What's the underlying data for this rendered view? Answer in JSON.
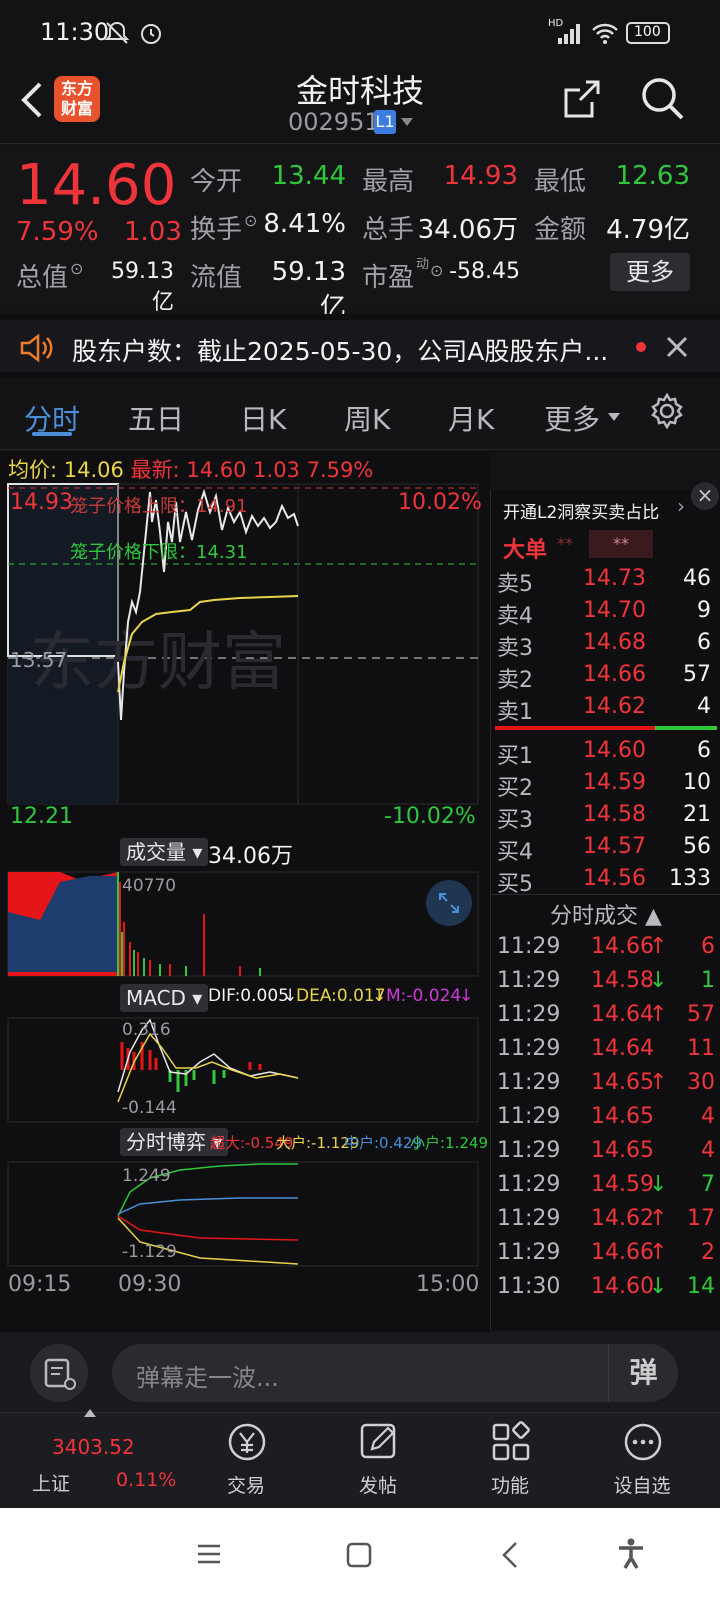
{
  "status_bar": {
    "time": "11:30",
    "network": "HD",
    "battery": "100"
  },
  "header": {
    "logo_line1": "东方",
    "logo_line2": "财富",
    "title": "金时科技",
    "code": "002951",
    "level_badge": "L1"
  },
  "quote": {
    "price": "14.60",
    "change_pct": "7.59%",
    "change": "1.03",
    "open_label": "今开",
    "open": "13.44",
    "high_label": "最高",
    "high": "14.93",
    "low_label": "最低",
    "low": "12.63",
    "turnover_label": "换手",
    "turnover": "8.41%",
    "volume_label": "总手",
    "volume": "34.06万",
    "amount_label": "金额",
    "amount": "4.79亿",
    "mktcap_label": "总值",
    "mktcap": "59.13亿",
    "float_label": "流值",
    "float": "59.13亿",
    "pe_label": "市盈",
    "pe_sup": "动",
    "pe": "-58.45",
    "more_btn": "更多"
  },
  "notice": {
    "text": "股东户数：截止2025-05-30，公司A股股东户..."
  },
  "tabs": {
    "t1": "分时",
    "t2": "五日",
    "t3": "日K",
    "t4": "周K",
    "t5": "月K",
    "t6": "更多"
  },
  "chart": {
    "avg_label": "均价:",
    "avg": "14.06",
    "latest_label": "最新:",
    "latest": "14.60",
    "latest_chg": "1.03",
    "latest_pct": "7.59%",
    "top_price": "14.93",
    "upper_limit_label": "笼子价格上限：14.91",
    "lower_limit_label": "笼子价格下限：14.31",
    "top_pct": "10.02%",
    "mid_price": "13.57",
    "bottom_price": "12.21",
    "bottom_pct": "-10.02%",
    "watermark": "东方财富",
    "volume_tag": "成交量",
    "volume_total": "34.06万",
    "volume_max": "40770",
    "macd_tag": "MACD",
    "dif": "DIF:0.005",
    "dea": "DEA:0.017",
    "m": "M:-0.024",
    "macd_hi": "0.316",
    "macd_lo": "-0.144",
    "game_tag": "分时博弈",
    "super": "超大:-0.549",
    "large": "大户:-1.129",
    "medium": "中户:0.429",
    "small": "小户:1.249",
    "game_hi": "1.249",
    "game_lo": "-1.129",
    "t_start": "09:15",
    "t_open": "09:30",
    "t_end": "15:00"
  },
  "book": {
    "l2_prompt": "开通L2洞察买卖占比",
    "big_order": "大单",
    "big_stars1": "**",
    "big_stars2": "**",
    "asks": [
      {
        "label": "卖5",
        "price": "14.73",
        "vol": "46"
      },
      {
        "label": "卖4",
        "price": "14.70",
        "vol": "9"
      },
      {
        "label": "卖3",
        "price": "14.68",
        "vol": "6"
      },
      {
        "label": "卖2",
        "price": "14.66",
        "vol": "57"
      },
      {
        "label": "卖1",
        "price": "14.62",
        "vol": "4"
      }
    ],
    "bids": [
      {
        "label": "买1",
        "price": "14.60",
        "vol": "6"
      },
      {
        "label": "买2",
        "price": "14.59",
        "vol": "10"
      },
      {
        "label": "买3",
        "price": "14.58",
        "vol": "21"
      },
      {
        "label": "买4",
        "price": "14.57",
        "vol": "56"
      },
      {
        "label": "买5",
        "price": "14.56",
        "vol": "133"
      }
    ],
    "ticks_title": "分时成交",
    "ticks": [
      {
        "time": "11:29",
        "price": "14.66",
        "dir": "↑",
        "vol": "6"
      },
      {
        "time": "11:29",
        "price": "14.58",
        "dir": "↓",
        "vol": "1"
      },
      {
        "time": "11:29",
        "price": "14.64",
        "dir": "↑",
        "vol": "57"
      },
      {
        "time": "11:29",
        "price": "14.64",
        "dir": "",
        "vol": "11"
      },
      {
        "time": "11:29",
        "price": "14.65",
        "dir": "↑",
        "vol": "30"
      },
      {
        "time": "11:29",
        "price": "14.65",
        "dir": "",
        "vol": "4"
      },
      {
        "time": "11:29",
        "price": "14.65",
        "dir": "",
        "vol": "4"
      },
      {
        "time": "11:29",
        "price": "14.59",
        "dir": "↓",
        "vol": "7"
      },
      {
        "time": "11:29",
        "price": "14.62",
        "dir": "↑",
        "vol": "17"
      },
      {
        "time": "11:29",
        "price": "14.66",
        "dir": "↑",
        "vol": "2"
      },
      {
        "time": "11:30",
        "price": "14.60",
        "dir": "↓",
        "vol": "14"
      }
    ]
  },
  "comment_bar": {
    "placeholder": "弹幕走一波...",
    "danmu_btn": "弹"
  },
  "bottom_bar": {
    "index_value": "3403.52",
    "index_name": "上证",
    "index_pct": "0.11%",
    "trade": "交易",
    "post": "发帖",
    "functions": "功能",
    "watchlist": "设自选"
  },
  "colors": {
    "up": "#f0353a",
    "down": "#2fc73b",
    "accent": "#4a8fd8",
    "avg_line": "#e8d44a"
  }
}
